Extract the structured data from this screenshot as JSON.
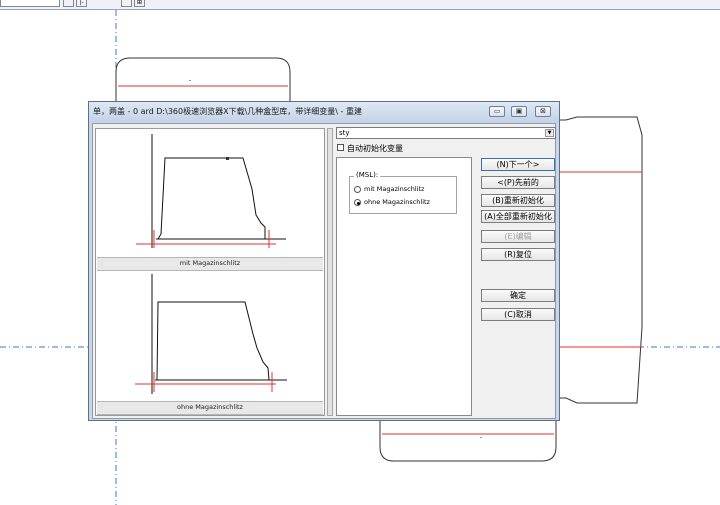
{
  "toolbar": {
    "btn1": "",
    "btn2": "|-",
    "btn3": "",
    "btn4": "⊞"
  },
  "dialog": {
    "title": "单，两盖 - 0 ard D:\\360极速浏览器X下载\\几种盒型库，带详细变量\\ - 重建",
    "window_buttons": {
      "minimize": "▭",
      "maximize": "▣",
      "close": "⊠"
    }
  },
  "preview": {
    "top_caption": "mit Magazinschlitz",
    "bottom_caption": "ohne Magazinschlitz"
  },
  "style_combo": {
    "value": "sty"
  },
  "auto_init": {
    "label": "自动初始化变量",
    "checked": false
  },
  "group": {
    "legend": "(MSL):",
    "options": [
      {
        "label": "mit Magazinschlitz",
        "selected": false
      },
      {
        "label": "ohne Magazinschlitz",
        "selected": true
      }
    ]
  },
  "buttons": {
    "next": "(N)下一个>",
    "prev": "<(P)先前的",
    "reinit": "(B)重新初始化",
    "reinit_all": "(A)全部重新初始化",
    "edit": "(E)编辑",
    "reset": "(R)复位",
    "ok": "确定",
    "cancel": "(C)取消"
  },
  "colors": {
    "cut_line": "#e03030",
    "guide_line": "#3a78c8",
    "outline": "#333333"
  }
}
